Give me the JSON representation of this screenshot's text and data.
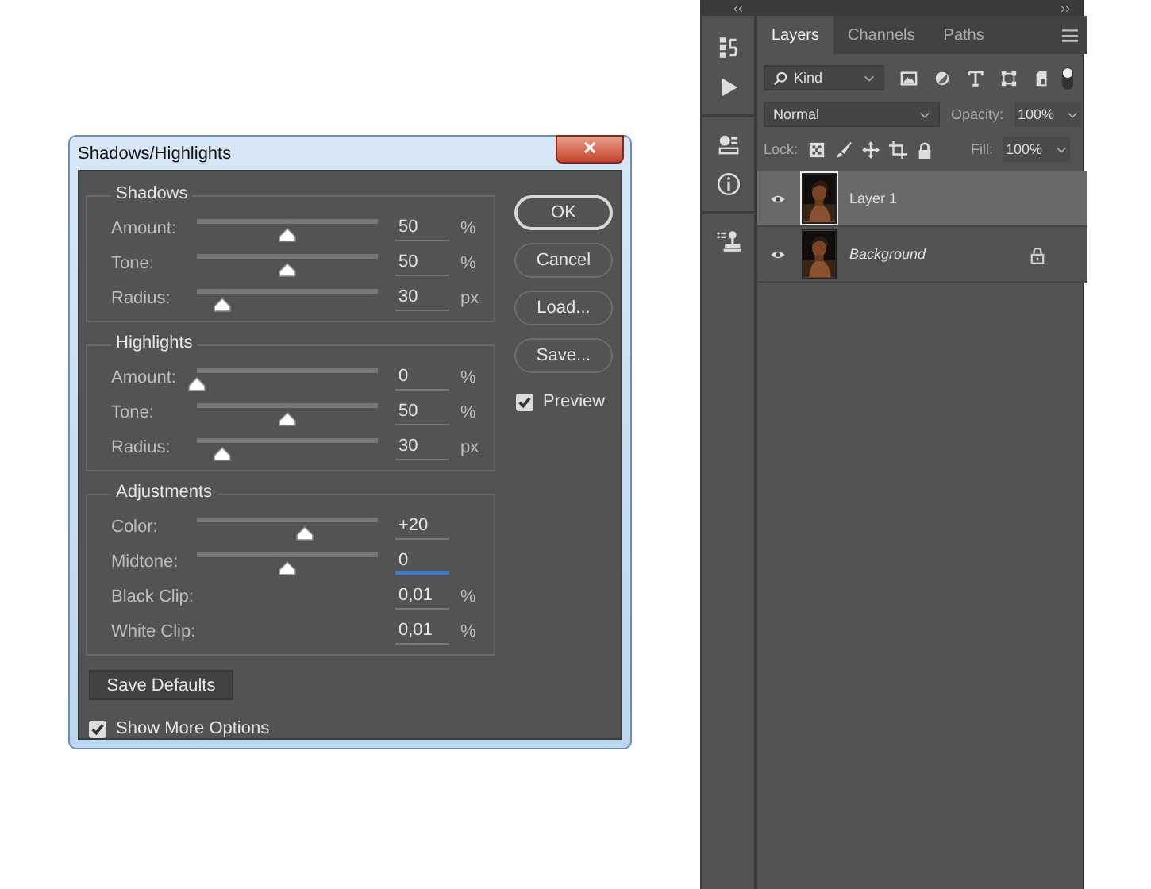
{
  "dialog": {
    "title": "Shadows/Highlights",
    "close": "✕",
    "groups": [
      {
        "title": "Shadows",
        "rows": [
          {
            "kind": "slider",
            "label": "Amount:",
            "level": 0.5,
            "value": "50",
            "unit": "%",
            "focused": false
          },
          {
            "kind": "slider",
            "label": "Tone:",
            "level": 0.5,
            "value": "50",
            "unit": "%",
            "focused": false
          },
          {
            "kind": "slider",
            "label": "Radius:",
            "level": 0.14,
            "value": "30",
            "unit": "px",
            "focused": false
          }
        ]
      },
      {
        "title": "Highlights",
        "rows": [
          {
            "kind": "slider",
            "label": "Amount:",
            "level": 0.0,
            "value": "0",
            "unit": "%",
            "focused": false
          },
          {
            "kind": "slider",
            "label": "Tone:",
            "level": 0.5,
            "value": "50",
            "unit": "%",
            "focused": false
          },
          {
            "kind": "slider",
            "label": "Radius:",
            "level": 0.14,
            "value": "30",
            "unit": "px",
            "focused": false
          }
        ]
      },
      {
        "title": "Adjustments",
        "rows": [
          {
            "kind": "slider",
            "label": "Color:",
            "level": 0.6,
            "value": "+20",
            "focused": false
          },
          {
            "kind": "slider",
            "label": "Midtone:",
            "level": 0.5,
            "value": "0",
            "focused": true
          },
          {
            "kind": "field",
            "label": "Black Clip:",
            "value": "0,01",
            "unit": "%",
            "focused": false
          },
          {
            "kind": "field",
            "label": "White Clip:",
            "value": "0,01",
            "unit": "%",
            "focused": false
          }
        ]
      }
    ],
    "buttons": [
      {
        "label": "OK",
        "default": true
      },
      {
        "label": "Cancel",
        "default": false
      },
      {
        "label": "Load...",
        "default": false
      },
      {
        "label": "Save...",
        "default": false
      }
    ],
    "preview": {
      "label": "Preview",
      "checked": true
    },
    "save_defaults": "Save Defaults",
    "show_more": {
      "label": "Show More Options",
      "checked": true
    }
  },
  "panel": {
    "collapse": "‹‹",
    "expand": "››",
    "tabs": [
      {
        "label": "Layers",
        "selected": true
      },
      {
        "label": "Channels",
        "selected": false
      },
      {
        "label": "Paths",
        "selected": false
      }
    ],
    "filter": "Kind",
    "filter_on": true,
    "blend_mode": "Normal",
    "opacity_label": "Opacity:",
    "opacity": "100%",
    "lock_label": "Lock:",
    "fill_label": "Fill:",
    "fill": "100%",
    "layers": [
      {
        "name": "Layer 1",
        "selected": true,
        "italic": false,
        "locked": false
      },
      {
        "name": "Background",
        "selected": false,
        "italic": true,
        "locked": true
      }
    ]
  }
}
